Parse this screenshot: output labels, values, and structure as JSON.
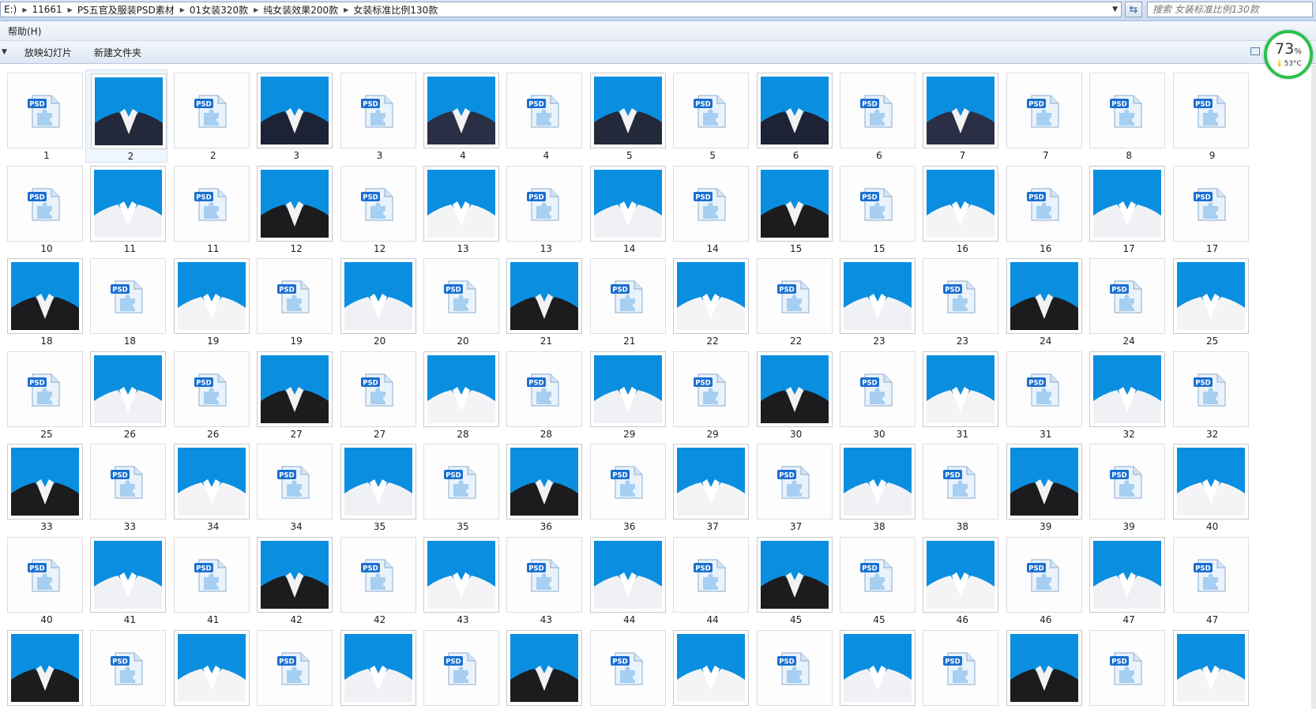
{
  "address_bar": {
    "crumbs": [
      "E:)",
      "11661",
      "PS五官及服装PSD素材",
      "01女装320款",
      "纯女装效果200款",
      "女装标准比例130款"
    ],
    "search_placeholder": "搜索 女装标准比例130款"
  },
  "menu": {
    "items": [
      "帮助(H)"
    ]
  },
  "toolbar": {
    "slideshow_label": "放映幻灯片",
    "new_folder_label": "新建文件夹"
  },
  "gauge": {
    "percent": "73",
    "percent_sign": "%",
    "temperature": "53°C"
  },
  "colors": {
    "photo_sky": "#0a8ee0",
    "gauge_ring": "#27c24c",
    "psd_badge": "#1a6fd0"
  },
  "icons": {
    "psd_file": "psd-file-icon",
    "outfit_preview": "outfit-photo"
  },
  "files": [
    {
      "label": "1",
      "kind": "psd"
    },
    {
      "label": "2",
      "kind": "photo",
      "selected": true
    },
    {
      "label": "2",
      "kind": "psd"
    },
    {
      "label": "3",
      "kind": "photo"
    },
    {
      "label": "3",
      "kind": "psd"
    },
    {
      "label": "4",
      "kind": "photo"
    },
    {
      "label": "4",
      "kind": "psd"
    },
    {
      "label": "5",
      "kind": "photo"
    },
    {
      "label": "5",
      "kind": "psd"
    },
    {
      "label": "6",
      "kind": "photo"
    },
    {
      "label": "6",
      "kind": "psd"
    },
    {
      "label": "7",
      "kind": "photo"
    },
    {
      "label": "7",
      "kind": "psd"
    },
    {
      "label": "8",
      "kind": "psd"
    },
    {
      "label": "9",
      "kind": "psd"
    },
    {
      "label": "10",
      "kind": "psd"
    },
    {
      "label": "11",
      "kind": "photo"
    },
    {
      "label": "11",
      "kind": "psd"
    },
    {
      "label": "12",
      "kind": "photo"
    },
    {
      "label": "12",
      "kind": "psd"
    },
    {
      "label": "13",
      "kind": "photo"
    },
    {
      "label": "13",
      "kind": "psd"
    },
    {
      "label": "14",
      "kind": "photo"
    },
    {
      "label": "14",
      "kind": "psd"
    },
    {
      "label": "15",
      "kind": "photo"
    },
    {
      "label": "15",
      "kind": "psd"
    },
    {
      "label": "16",
      "kind": "photo"
    },
    {
      "label": "16",
      "kind": "psd"
    },
    {
      "label": "17",
      "kind": "photo"
    },
    {
      "label": "17",
      "kind": "psd"
    },
    {
      "label": "18",
      "kind": "photo"
    },
    {
      "label": "18",
      "kind": "psd"
    },
    {
      "label": "19",
      "kind": "photo"
    },
    {
      "label": "19",
      "kind": "psd"
    },
    {
      "label": "20",
      "kind": "photo"
    },
    {
      "label": "20",
      "kind": "psd"
    },
    {
      "label": "21",
      "kind": "photo"
    },
    {
      "label": "21",
      "kind": "psd"
    },
    {
      "label": "22",
      "kind": "photo"
    },
    {
      "label": "22",
      "kind": "psd"
    },
    {
      "label": "23",
      "kind": "photo"
    },
    {
      "label": "23",
      "kind": "psd"
    },
    {
      "label": "24",
      "kind": "photo"
    },
    {
      "label": "24",
      "kind": "psd"
    },
    {
      "label": "25",
      "kind": "photo"
    },
    {
      "label": "25",
      "kind": "psd"
    },
    {
      "label": "26",
      "kind": "photo"
    },
    {
      "label": "26",
      "kind": "psd"
    },
    {
      "label": "27",
      "kind": "photo"
    },
    {
      "label": "27",
      "kind": "psd"
    },
    {
      "label": "28",
      "kind": "photo"
    },
    {
      "label": "28",
      "kind": "psd"
    },
    {
      "label": "29",
      "kind": "photo"
    },
    {
      "label": "29",
      "kind": "psd"
    },
    {
      "label": "30",
      "kind": "photo"
    },
    {
      "label": "30",
      "kind": "psd"
    },
    {
      "label": "31",
      "kind": "photo"
    },
    {
      "label": "31",
      "kind": "psd"
    },
    {
      "label": "32",
      "kind": "photo"
    },
    {
      "label": "32",
      "kind": "psd"
    },
    {
      "label": "33",
      "kind": "photo"
    },
    {
      "label": "33",
      "kind": "psd"
    },
    {
      "label": "34",
      "kind": "photo"
    },
    {
      "label": "34",
      "kind": "psd"
    },
    {
      "label": "35",
      "kind": "photo"
    },
    {
      "label": "35",
      "kind": "psd"
    },
    {
      "label": "36",
      "kind": "photo"
    },
    {
      "label": "36",
      "kind": "psd"
    },
    {
      "label": "37",
      "kind": "photo"
    },
    {
      "label": "37",
      "kind": "psd"
    },
    {
      "label": "38",
      "kind": "photo"
    },
    {
      "label": "38",
      "kind": "psd"
    },
    {
      "label": "39",
      "kind": "photo"
    },
    {
      "label": "39",
      "kind": "psd"
    },
    {
      "label": "40",
      "kind": "photo"
    },
    {
      "label": "40",
      "kind": "psd"
    },
    {
      "label": "41",
      "kind": "photo"
    },
    {
      "label": "41",
      "kind": "psd"
    },
    {
      "label": "42",
      "kind": "photo"
    },
    {
      "label": "42",
      "kind": "psd"
    },
    {
      "label": "43",
      "kind": "photo"
    },
    {
      "label": "43",
      "kind": "psd"
    },
    {
      "label": "44",
      "kind": "photo"
    },
    {
      "label": "44",
      "kind": "psd"
    },
    {
      "label": "45",
      "kind": "photo"
    },
    {
      "label": "45",
      "kind": "psd"
    },
    {
      "label": "46",
      "kind": "photo"
    },
    {
      "label": "46",
      "kind": "psd"
    },
    {
      "label": "47",
      "kind": "photo"
    },
    {
      "label": "47",
      "kind": "psd"
    },
    {
      "label": "",
      "kind": "photo"
    },
    {
      "label": "",
      "kind": "psd"
    },
    {
      "label": "",
      "kind": "photo"
    },
    {
      "label": "",
      "kind": "psd"
    },
    {
      "label": "",
      "kind": "photo"
    },
    {
      "label": "",
      "kind": "psd"
    },
    {
      "label": "",
      "kind": "photo"
    },
    {
      "label": "",
      "kind": "psd"
    },
    {
      "label": "",
      "kind": "photo"
    },
    {
      "label": "",
      "kind": "psd"
    },
    {
      "label": "",
      "kind": "photo"
    },
    {
      "label": "",
      "kind": "psd"
    },
    {
      "label": "",
      "kind": "photo"
    },
    {
      "label": "",
      "kind": "psd"
    },
    {
      "label": "",
      "kind": "photo"
    }
  ]
}
